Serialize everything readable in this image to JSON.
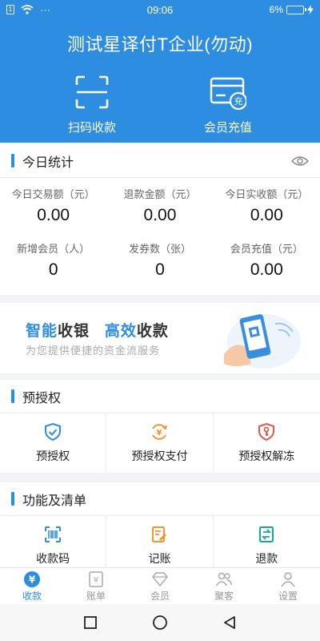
{
  "status_bar": {
    "sim": "1",
    "dots": "···",
    "time": "09:06",
    "battery_percent": "6%"
  },
  "header": {
    "title": "测试星译付T企业(勿动)",
    "actions": [
      {
        "label": "扫码收款",
        "icon": "scan-icon"
      },
      {
        "label": "会员充值",
        "icon": "member-recharge-icon"
      }
    ]
  },
  "stats": {
    "title": "今日统计",
    "items": [
      {
        "label": "今日交易额（元）",
        "value": "0.00"
      },
      {
        "label": "退款金额（元）",
        "value": "0.00"
      },
      {
        "label": "今日实收额（元）",
        "value": "0.00"
      },
      {
        "label": "新增会员（人）",
        "value": "0"
      },
      {
        "label": "发券数（张）",
        "value": "0"
      },
      {
        "label": "会员充值（元）",
        "value": "0.00"
      }
    ]
  },
  "banner": {
    "word1_accent": "智能",
    "word1_rest": "收银",
    "word2_accent": "高效",
    "word2_rest": "收款",
    "subtitle": "为您提供便捷的资金流服务"
  },
  "preauth": {
    "title": "预授权",
    "items": [
      {
        "label": "预授权",
        "icon": "shield-check-icon"
      },
      {
        "label": "预授权支付",
        "icon": "yuan-refresh-icon"
      },
      {
        "label": "预授权解冻",
        "icon": "shield-key-icon"
      }
    ]
  },
  "functions": {
    "title": "功能及清单",
    "items": [
      {
        "label": "收款码",
        "icon": "barcode-icon"
      },
      {
        "label": "记账",
        "icon": "notebook-icon"
      },
      {
        "label": "退款",
        "icon": "refund-icon"
      }
    ]
  },
  "tabbar": {
    "items": [
      {
        "label": "收款",
        "icon": "yuan-circle-icon",
        "active": true
      },
      {
        "label": "账单",
        "icon": "bill-icon",
        "active": false
      },
      {
        "label": "会员",
        "icon": "diamond-icon",
        "active": false
      },
      {
        "label": "聚客",
        "icon": "group-icon",
        "active": false
      },
      {
        "label": "设置",
        "icon": "person-icon",
        "active": false
      }
    ]
  },
  "colors": {
    "brand": "#2d8de0",
    "orange": "#f0962a",
    "red": "#e05a4a",
    "teal": "#1aa59a"
  }
}
